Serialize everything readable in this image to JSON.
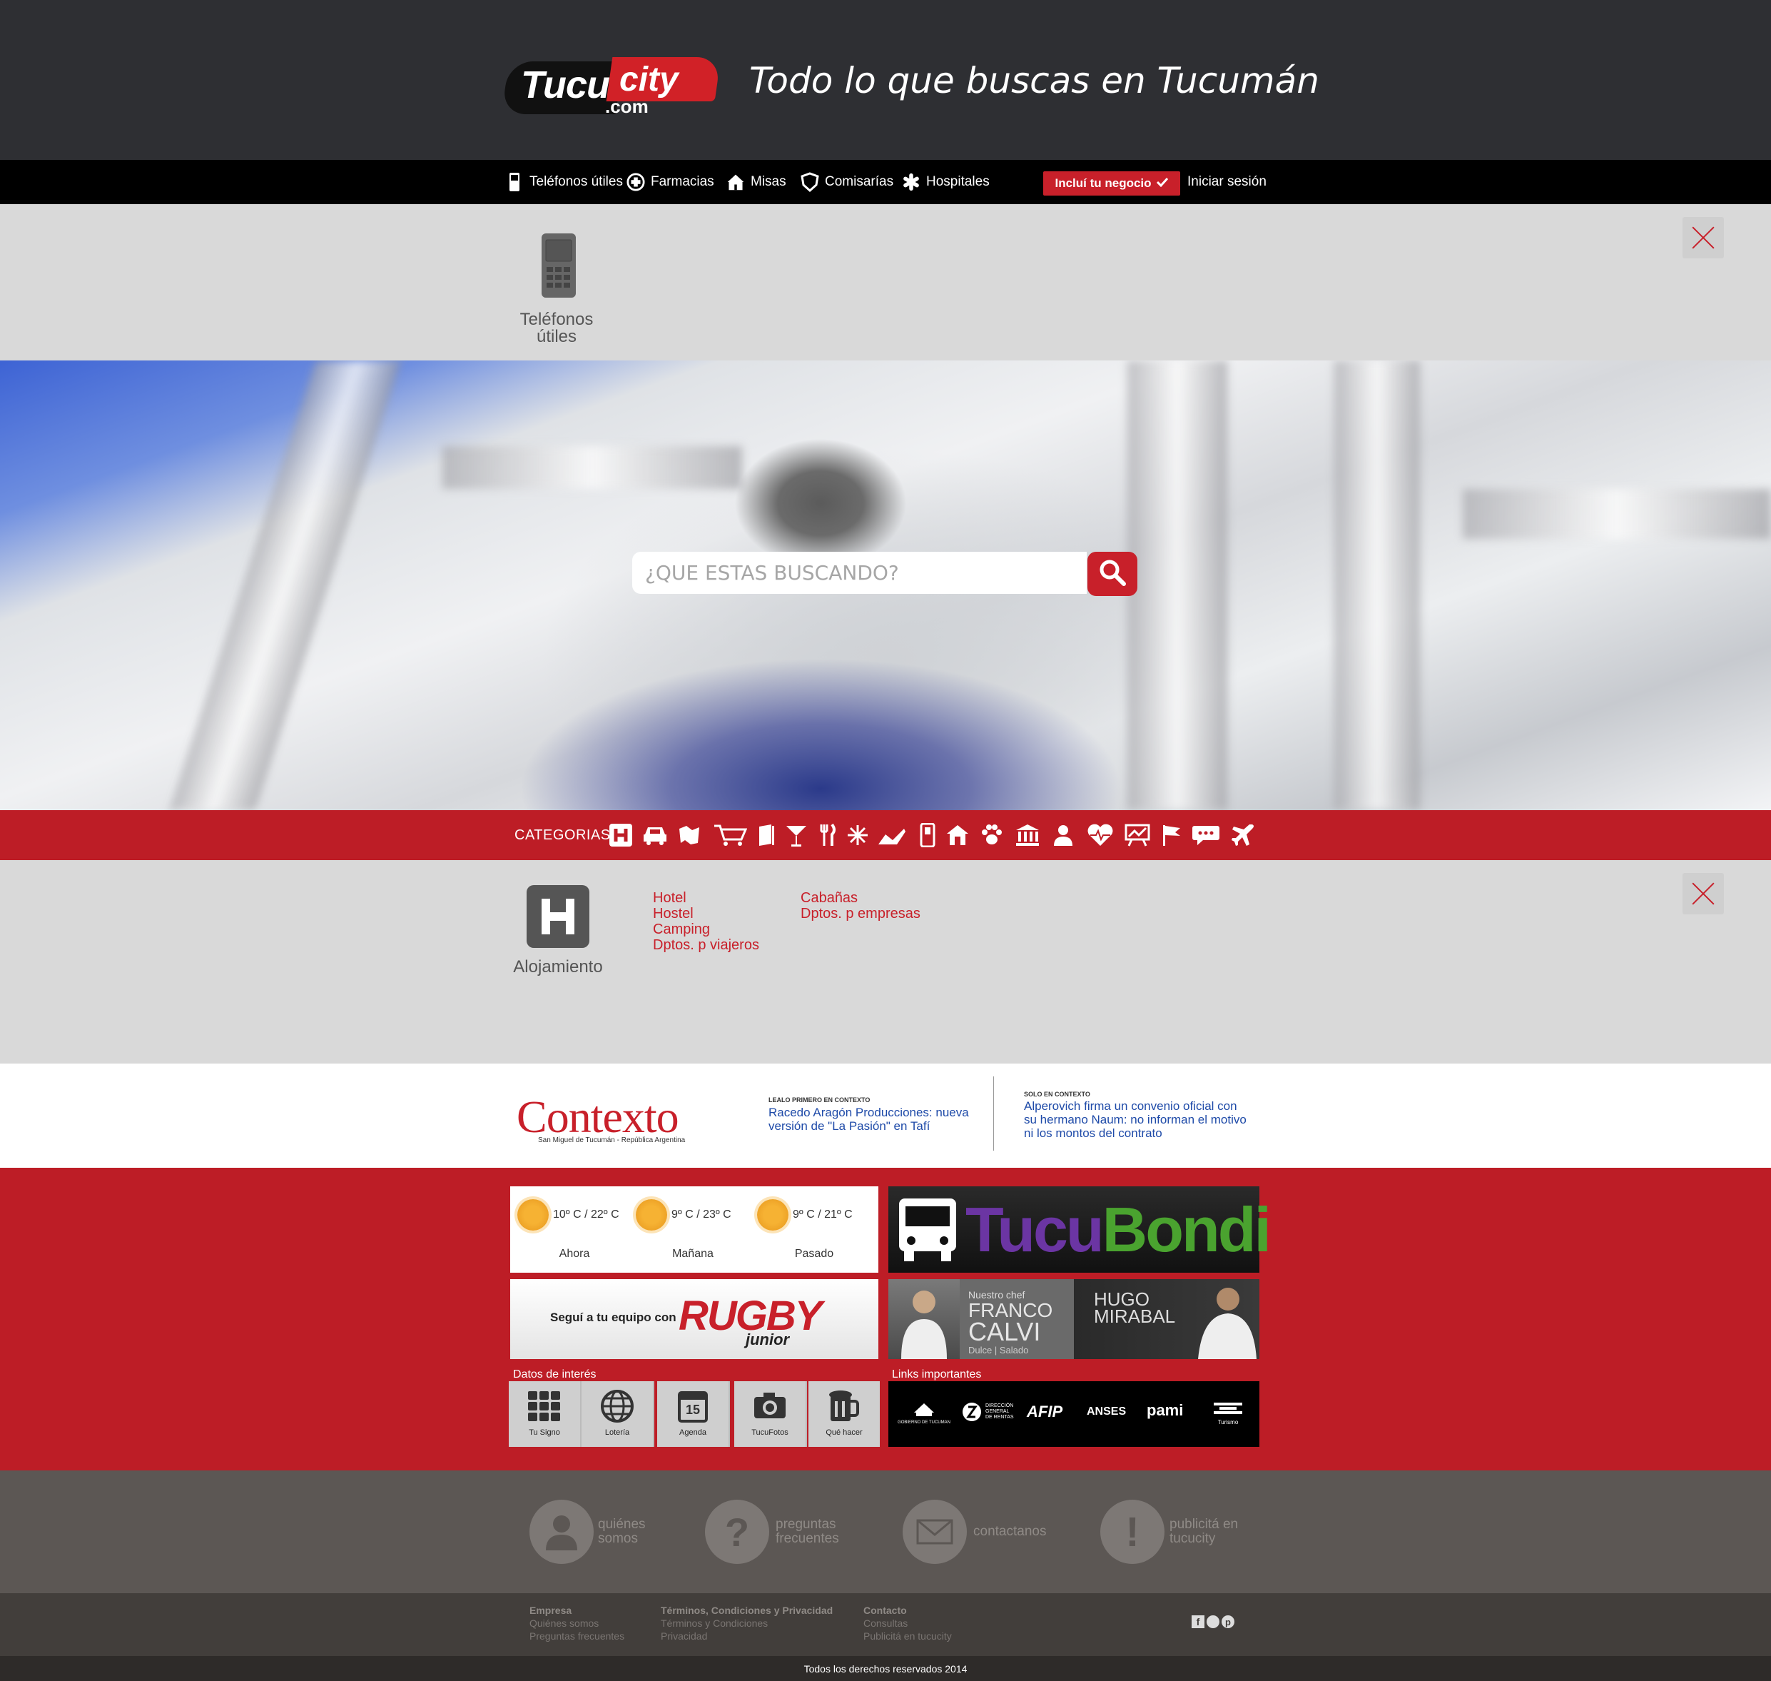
{
  "header": {
    "logo": {
      "word1": "Tucu",
      "word2": "city",
      "domain": ".com"
    },
    "tagline": "Todo lo que buscas en Tucumán"
  },
  "topnav": {
    "items": [
      {
        "label": "Teléfonos útiles",
        "icon": "phone-icon"
      },
      {
        "label": "Farmacias",
        "icon": "cross-icon"
      },
      {
        "label": "Misas",
        "icon": "church-icon"
      },
      {
        "label": "Comisarías",
        "icon": "badge-icon"
      },
      {
        "label": "Hospitales",
        "icon": "asterisk-icon"
      }
    ],
    "include_button": "Incluí tu negocio",
    "login": "Iniciar sesión"
  },
  "phones_panel": {
    "label_line1": "Teléfonos",
    "label_line2": "útiles"
  },
  "search": {
    "placeholder": "¿QUE ESTAS BUSCANDO?"
  },
  "categories": {
    "label": "CATEGORIAS",
    "icons": [
      "hotel-icon",
      "car-icon",
      "map-icon",
      "cart-icon",
      "book-icon",
      "cocktail-icon",
      "cutlery-icon",
      "snowflake-icon",
      "shoe-icon",
      "phone-device-icon",
      "house-icon",
      "paw-icon",
      "bank-icon",
      "person-icon",
      "heart-icon",
      "presentation-icon",
      "flag-icon",
      "chat-icon",
      "plane-icon"
    ]
  },
  "accommodation": {
    "label": "Alojamiento",
    "links_col1": [
      "Hotel",
      "Hostel",
      "Camping",
      "Dptos. p viajeros"
    ],
    "links_col2": [
      "Cabañas",
      "Dptos. p empresas"
    ]
  },
  "contexto": {
    "logo": "Contexto",
    "subtitle": "San Miguel de Tucumán - República Argentina",
    "news1_kicker": "LEALO PRIMERO EN CONTEXTO",
    "news1": "Racedo Aragón Producciones: nueva versión de \"La Pasión\" en Tafí",
    "news2_kicker": "SOLO EN CONTEXTO",
    "news2": "Alperovich firma un convenio oficial con su hermano Naum: no informan el motivo ni los montos del contrato"
  },
  "weather": [
    {
      "temp": "10º C / 22º C",
      "day": "Ahora"
    },
    {
      "temp": "9º C / 23º C",
      "day": "Mañana"
    },
    {
      "temp": "9º C / 21º C",
      "day": "Pasado"
    }
  ],
  "rugby": {
    "lead": "Seguí a tu equipo con",
    "brand": "RUGBY",
    "brand_sub": "junior"
  },
  "tucubondi": {
    "word1": "Tucu",
    "word2": "Bondi"
  },
  "chefs": {
    "chef_label": "Nuestro chef",
    "chef1_first": "FRANCO",
    "chef1_last": "CALVI",
    "chef1_tag": "Dulce | Salado",
    "chef2_first": "HUGO",
    "chef2_last": "MIRABAL"
  },
  "datos": {
    "title": "Datos de interés",
    "tiles": [
      "Tu Signo",
      "Lotería",
      "Agenda",
      "TucuFotos",
      "Qué hacer"
    ],
    "agenda_day": "15"
  },
  "links": {
    "title": "Links importantes",
    "logos": [
      "GOBIERNO DE TUCUMAN",
      "DIRECCIÓN GENERAL DE RENTAS",
      "AFIP",
      "ANSES",
      "pami",
      "Turismo"
    ]
  },
  "footer_features": [
    {
      "line1": "quiénes",
      "line2": "somos"
    },
    {
      "line1": "preguntas",
      "line2": "frecuentes"
    },
    {
      "line1": "contactanos",
      "line2": ""
    },
    {
      "line1": "publicitá en",
      "line2": "tucucity"
    }
  ],
  "footer_links": {
    "col1": {
      "title": "Empresa",
      "items": [
        "Quiénes somos",
        "Preguntas frecuentes"
      ]
    },
    "col2": {
      "title": "Términos, Condiciones y Privacidad",
      "items": [
        "Términos y Condiciones",
        "Privacidad"
      ]
    },
    "col3": {
      "title": "Contacto",
      "items": [
        "Consultas",
        "Publicitá en tucucity"
      ]
    }
  },
  "copyright": "Todos los derechos reservados 2014",
  "colors": {
    "brand_red": "#bd1d26",
    "header_dark": "#2e2f33",
    "panel_grey": "#d9d9d9"
  }
}
